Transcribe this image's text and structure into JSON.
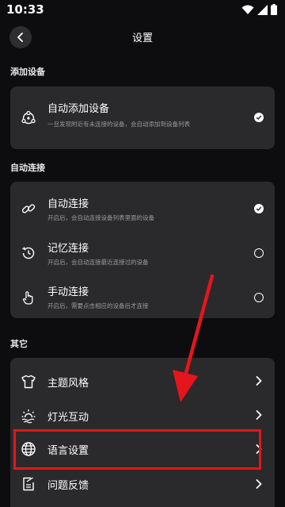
{
  "status": {
    "time": "10:33"
  },
  "header": {
    "title": "设置"
  },
  "sections": {
    "add_device": {
      "label": "添加设备",
      "items": [
        {
          "title": "自动添加设备",
          "desc": "一旦发现附近有未连接的设备，会自动添加到设备列表",
          "state": "checked",
          "icon": "device-hub-icon"
        }
      ]
    },
    "auto_connect": {
      "label": "自动连接",
      "items": [
        {
          "title": "自动连接",
          "desc": "开启后，会自动连接设备列表里面的设备",
          "state": "checked",
          "icon": "link-icon"
        },
        {
          "title": "记忆连接",
          "desc": "开启后，会自动连接最近连接过的设备",
          "state": "unchecked",
          "icon": "history-icon"
        },
        {
          "title": "手动连接",
          "desc": "开启后，需要点击相应的设备后才连接",
          "state": "unchecked",
          "icon": "hand-tap-icon"
        }
      ]
    },
    "other": {
      "label": "其它",
      "items": [
        {
          "title": "主题风格",
          "icon": "tshirt-icon"
        },
        {
          "title": "灯光互动",
          "icon": "light-icon"
        },
        {
          "title": "语言设置",
          "icon": "globe-icon"
        },
        {
          "title": "问题反馈",
          "icon": "feedback-icon"
        }
      ]
    }
  },
  "colors": {
    "background": "#0d0d0f",
    "card": "#2a2a2c",
    "annotation": "#e4161c"
  }
}
